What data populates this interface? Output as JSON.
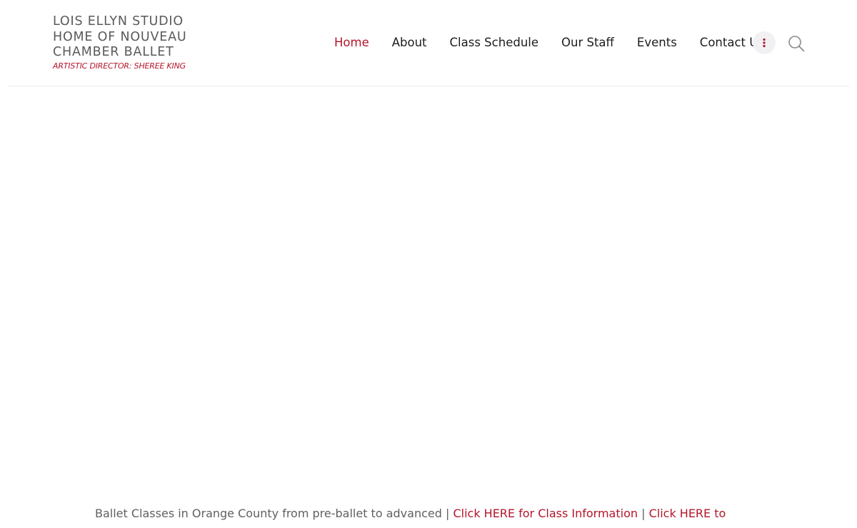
{
  "site": {
    "title": "LOIS ELLYN STUDIO\nHOME OF NOUVEAU\nCHAMBER BALLET",
    "tagline": "ARTISTIC DIRECTOR: SHEREE KING"
  },
  "nav": {
    "items": [
      {
        "label": "Home",
        "active": true
      },
      {
        "label": "About"
      },
      {
        "label": "Class Schedule"
      },
      {
        "label": "Our Staff"
      },
      {
        "label": "Events"
      },
      {
        "label": "Contact Us"
      }
    ],
    "more_icon": "vertical-dots-icon",
    "search_icon": "search-icon"
  },
  "intro": {
    "text": "Ballet Classes in Orange County from pre-ballet to advanced",
    "separator": "|",
    "link_1": "Click HERE for Class Information",
    "link_2": "Click HERE to"
  },
  "colors": {
    "accent": "#b5152b",
    "text": "#1c1c1c",
    "muted": "#606060",
    "brand": "#5a5a5a",
    "button_bg": "#f1f1f4",
    "divider": "#ececec"
  }
}
